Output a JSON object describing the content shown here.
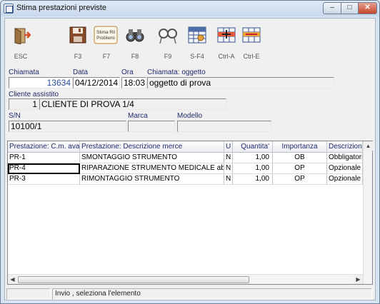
{
  "window": {
    "title": "Stima prestazioni previste",
    "controls": {
      "minimize": "–",
      "maximize": "□",
      "close": "✕"
    }
  },
  "toolbar": {
    "buttons": [
      {
        "id": "esc",
        "label": "ESC",
        "icon": "exit-door-icon"
      },
      {
        "id": "f3",
        "label": "F3",
        "icon": "save-disk-icon"
      },
      {
        "id": "f7",
        "label": "F7",
        "icon": "stima-ril-problemi-icon",
        "icon_text": "Stima Ril\nProblemi"
      },
      {
        "id": "f8",
        "label": "F8",
        "icon": "binoculars-icon"
      },
      {
        "id": "f9",
        "label": "F9",
        "icon": "glasses-icon"
      },
      {
        "id": "sf4",
        "label": "S-F4",
        "icon": "grid-settings-icon"
      },
      {
        "id": "ctrla",
        "label": "Ctrl-A",
        "icon": "add-row-icon"
      },
      {
        "id": "ctrle",
        "label": "Ctrl-E",
        "icon": "remove-row-icon"
      }
    ]
  },
  "form": {
    "chiamata": {
      "label": "Chiamata",
      "value": "13634"
    },
    "data": {
      "label": "Data",
      "value": "04/12/2014"
    },
    "ora": {
      "label": "Ora",
      "value": "18:03"
    },
    "oggetto": {
      "label": "Chiamata: oggetto",
      "value": "oggetto di prova"
    },
    "cliente": {
      "label": "Cliente assistito",
      "code": "1",
      "name": "CLIENTE DI PROVA 1/4"
    },
    "sn": {
      "label": "S/N",
      "value": "10100/1"
    },
    "marca": {
      "label": "Marca",
      "value": ""
    },
    "modello": {
      "label": "Modello",
      "value": ""
    }
  },
  "grid": {
    "columns": [
      "Prestazione: C.m. avan:",
      "Prestazione: Descrizione merce",
      "U",
      "Quantita'",
      "Importanza",
      "Descrizione i"
    ],
    "rows": [
      {
        "code": "PR-1",
        "desc": "SMONTAGGIO STRUMENTO",
        "u": "N",
        "qty": "1,00",
        "imp": "OB",
        "desc_imp": "Obbligatoria"
      },
      {
        "code": "PR-4",
        "desc": "RIPARAZIONE STRUMENTO MEDICALE abcde",
        "u": "N",
        "qty": "1,00",
        "imp": "OP",
        "desc_imp": "Opzionale"
      },
      {
        "code": "PR-3",
        "desc": "RIMONTAGGIO STRUMENTO",
        "u": "N",
        "qty": "1,00",
        "imp": "OP",
        "desc_imp": "Opzionale"
      }
    ]
  },
  "statusbar": {
    "field1": "",
    "message": "Invio , seleziona l'elemento"
  }
}
